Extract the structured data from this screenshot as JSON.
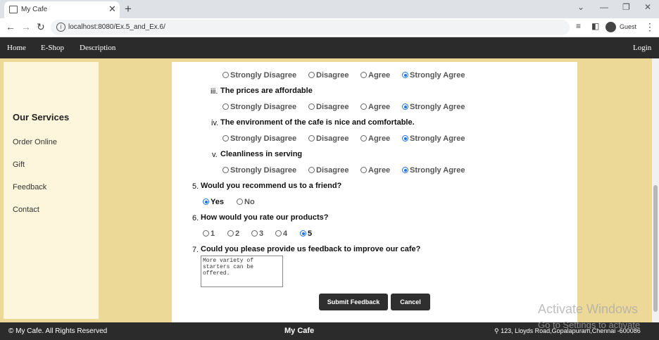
{
  "browser": {
    "tab_title": "My Cafe",
    "url": "localhost:8080/Ex.5_and_Ex.6/",
    "profile": "Guest"
  },
  "nav": {
    "items": [
      "Home",
      "E-Shop",
      "Description"
    ],
    "login": "Login"
  },
  "sidebar": {
    "title": "Our Services",
    "items": [
      "Order Online",
      "Gift",
      "Feedback",
      "Contact"
    ]
  },
  "form": {
    "agree_options": [
      "Strongly Disagree",
      "Disagree",
      "Agree",
      "Strongly Agree"
    ],
    "sub_questions": [
      {
        "num": "iii.",
        "text": "The prices are affordable",
        "selected": "Strongly Agree"
      },
      {
        "num": "iv.",
        "text": "The environment of the cafe is nice and comfortable.",
        "selected": "Strongly Agree"
      },
      {
        "num": "v.",
        "text": "Cleanliness in serving",
        "selected": "Strongly Agree"
      }
    ],
    "partial_row_selected": "Strongly Agree",
    "q5": {
      "num": "5.",
      "text": "Would you recommend us to a friend?",
      "options": [
        "Yes",
        "No"
      ],
      "selected": "Yes"
    },
    "q6": {
      "num": "6.",
      "text": "How would you rate our products?",
      "options": [
        "1",
        "2",
        "3",
        "4",
        "5"
      ],
      "selected": "5"
    },
    "q7": {
      "num": "7.",
      "text": "Could you please provide us feedback to improve our cafe?",
      "value": "More variety of starters can be offered."
    },
    "submit_label": "Submit Feedback",
    "cancel_label": "Cancel"
  },
  "footer": {
    "copyright": "© My Cafe. All Rights Reserved",
    "brand": "My Cafe",
    "address": "123, Lloyds Road,Gopalapuram,Chennai -600086"
  },
  "watermark": {
    "line1": "Activate Windows",
    "line2": "Go to Settings to activate"
  }
}
